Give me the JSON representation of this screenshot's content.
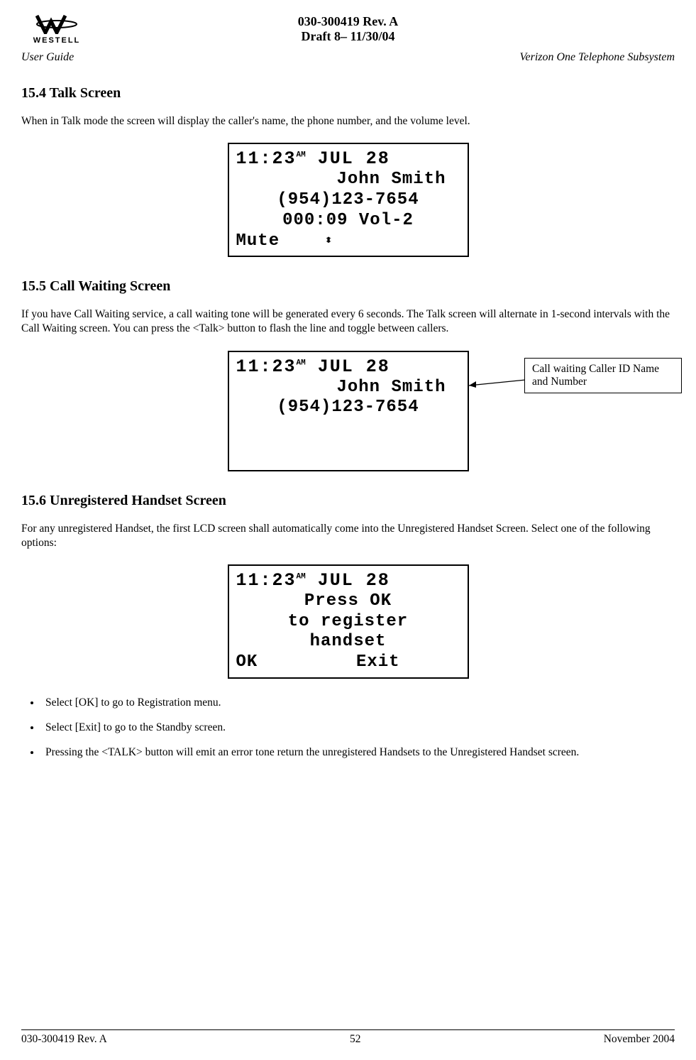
{
  "header": {
    "logo_brand": "WESTELL",
    "doc_id": "030-300419 Rev. A",
    "draft_line": "Draft 8– 11/30/04",
    "left_italic": "User Guide",
    "right_italic": "Verizon One Telephone Subsystem"
  },
  "section_15_4": {
    "heading": "15.4 Talk Screen",
    "body": "When in Talk mode the screen will display the caller's name, the phone number, and the volume level."
  },
  "lcd1": {
    "time_hhmm": "11:23",
    "time_ampm": "AM",
    "date": "JUL 28",
    "name": "John Smith",
    "phone": "(954)123-7654",
    "duration_vol": "000:09 Vol-2",
    "softkey_left": "Mute"
  },
  "section_15_5": {
    "heading": "15.5 Call Waiting Screen",
    "body": "If you have Call Waiting service, a call waiting tone will be generated every 6 seconds. The Talk screen will alternate in 1-second intervals with the Call Waiting screen. You can press the <Talk> button to flash the line and toggle between callers."
  },
  "lcd2": {
    "time_hhmm": "11:23",
    "time_ampm": "AM",
    "date": "JUL 28",
    "name": "John Smith",
    "phone": "(954)123-7654"
  },
  "callout": {
    "text": "Call waiting Caller ID Name and Number"
  },
  "section_15_6": {
    "heading": "15.6 Unregistered Handset Screen",
    "body": "For any unregistered Handset, the first LCD screen shall automatically come into the Unregistered Handset Screen. Select one of the following options:"
  },
  "lcd3": {
    "time_hhmm": "11:23",
    "time_ampm": "AM",
    "date": "JUL 28",
    "line2": "Press OK",
    "line3": "to register",
    "line4": "handset",
    "softkey_left": "OK",
    "softkey_right": "Exit"
  },
  "bullets": {
    "b1": "Select [OK] to go to Registration menu.",
    "b2": "Select [Exit] to go to the Standby screen.",
    "b3": "Pressing the <TALK> button will emit an error tone return the unregistered Handsets to the Unregistered Handset screen."
  },
  "footer": {
    "left": "030-300419 Rev. A",
    "center": "52",
    "right": "November 2004"
  }
}
